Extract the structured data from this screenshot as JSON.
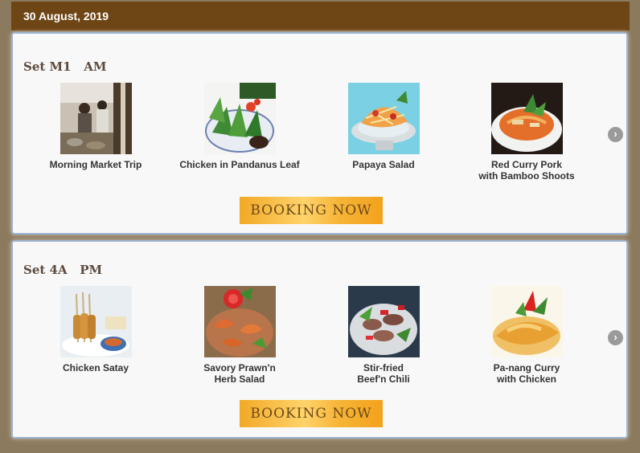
{
  "header": {
    "date": "30 August, 2019"
  },
  "sets": [
    {
      "title": "Set M1   AM",
      "items": [
        {
          "label": "Morning Market Trip",
          "icon": "market-photo"
        },
        {
          "label": "Chicken in Pandanus Leaf",
          "icon": "pandanus-chicken-photo"
        },
        {
          "label": "Papaya Salad",
          "icon": "papaya-salad-photo"
        },
        {
          "label": "Red Curry Pork\nwith Bamboo Shoots",
          "icon": "red-curry-photo"
        }
      ],
      "button_label": "BOOKING NOW"
    },
    {
      "title": "Set 4A   PM",
      "items": [
        {
          "label": "Chicken Satay",
          "icon": "satay-photo"
        },
        {
          "label": "Savory Prawn'n\nHerb Salad",
          "icon": "prawn-salad-photo"
        },
        {
          "label": "Stir-fried\nBeef'n Chili",
          "icon": "beef-chili-photo"
        },
        {
          "label": "Pa-nang Curry\nwith Chicken",
          "icon": "panang-curry-photo"
        }
      ],
      "button_label": "BOOKING NOW"
    }
  ],
  "colors": {
    "header_bg": "#6e4514",
    "page_bg": "#8c7a5e",
    "panel_border": "#9cb6d3",
    "button_gradient": "#f2a927"
  }
}
